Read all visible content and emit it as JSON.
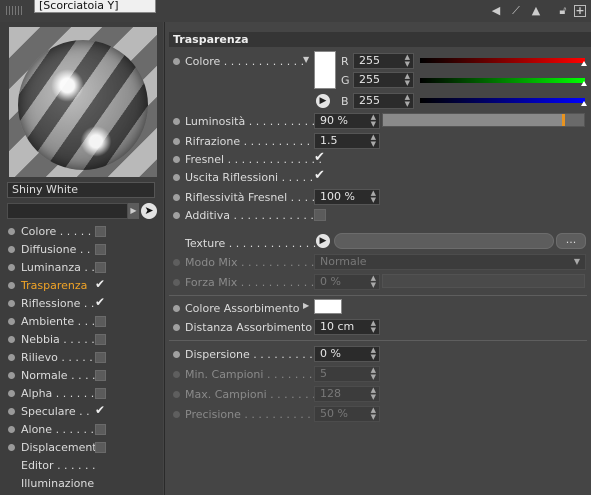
{
  "tooltip": "[Scorciatoia Y]",
  "toolbar": {
    "back_icon": "arrow-back-icon",
    "nav_icon": "nav-arrow-icon",
    "up_icon": "arrow-up-icon",
    "lock_icon": "lock-icon",
    "add_icon": "add-icon"
  },
  "material": {
    "name": "Shiny White",
    "channels": [
      {
        "label": "Colore",
        "dots": ". . . . .",
        "checked": false,
        "active": false
      },
      {
        "label": "Diffusione",
        "dots": ". .",
        "checked": false,
        "active": false
      },
      {
        "label": "Luminanza",
        "dots": ". .",
        "checked": false,
        "active": false
      },
      {
        "label": "Trasparenza",
        "dots": "",
        "checked": true,
        "active": true
      },
      {
        "label": "Riflessione",
        "dots": ". .",
        "checked": true,
        "active": false
      },
      {
        "label": "Ambiente",
        "dots": ". . .",
        "checked": false,
        "active": false
      },
      {
        "label": "Nebbia",
        "dots": ". . . . .",
        "checked": false,
        "active": false
      },
      {
        "label": "Rilievo",
        "dots": ". . . . .",
        "checked": false,
        "active": false
      },
      {
        "label": "Normale",
        "dots": ". . . .",
        "checked": false,
        "active": false
      },
      {
        "label": "Alpha",
        "dots": ". . . . . .",
        "checked": false,
        "active": false
      },
      {
        "label": "Speculare",
        "dots": ". .",
        "checked": true,
        "active": false
      },
      {
        "label": "Alone",
        "dots": ". . . . . .",
        "checked": false,
        "active": false
      },
      {
        "label": "Displacement",
        "dots": "",
        "checked": false,
        "active": false
      }
    ],
    "extra": [
      {
        "label": "Editor",
        "dots": ". . . . . ."
      },
      {
        "label": "Illuminazione",
        "dots": ""
      }
    ]
  },
  "section": {
    "title": "Trasparenza"
  },
  "color": {
    "label": "Colore",
    "dots": ". . . . . . . . . . . .",
    "swatch": "#ffffff",
    "r_label": "R",
    "r": "255",
    "g_label": "G",
    "g": "255",
    "b_label": "B",
    "b": "255",
    "r_fraction": 1,
    "g_fraction": 1,
    "b_fraction": 1
  },
  "params": {
    "luminosita": {
      "label": "Luminosità",
      "dots": ". . . . . . . . . . .",
      "value": "90 %",
      "fraction": 0.9
    },
    "rifrazione": {
      "label": "Rifrazione",
      "dots": ". . . . . . . . . . .",
      "value": "1.5"
    },
    "fresnel": {
      "label": "Fresnel",
      "dots": ". . . . . . . . . . . . . .",
      "checked": true
    },
    "uscita": {
      "label": "Uscita Riflessioni",
      "dots": ". . . . .",
      "checked": true
    },
    "riflessivita": {
      "label": "Riflessività Fresnel",
      "dots": ". . . .",
      "value": "100 %"
    },
    "additiva": {
      "label": "Additiva",
      "dots": ". . . . . . . . . . . . .",
      "checked": false
    },
    "texture": {
      "label": "Texture",
      "dots": ". . . . . . . . . . . . . .",
      "browse": "..."
    },
    "modo_mix": {
      "label": "Modo Mix",
      "dots": ". . . . . . . . . . .",
      "value": "Normale"
    },
    "forza_mix": {
      "label": "Forza Mix",
      "dots": ". . . . . . . . . . .",
      "value": "0 %"
    },
    "colore_ass": {
      "label": "Colore Assorbimento",
      "swatch": "#ffffff"
    },
    "distanza_ass": {
      "label": "Distanza Assorbimento",
      "value": "10 cm"
    },
    "dispersione": {
      "label": "Dispersione",
      "dots": ". . . . . . . . . . .",
      "value": "0 %"
    },
    "min_campioni": {
      "label": "Min. Campioni",
      "dots": ". . . . . . . .",
      "value": "5"
    },
    "max_campioni": {
      "label": "Max. Campioni",
      "dots": ". . . . . . . .",
      "value": "128"
    },
    "precisione": {
      "label": "Precisione",
      "dots": ". . . . . . . . . . .",
      "value": "50 %"
    }
  }
}
